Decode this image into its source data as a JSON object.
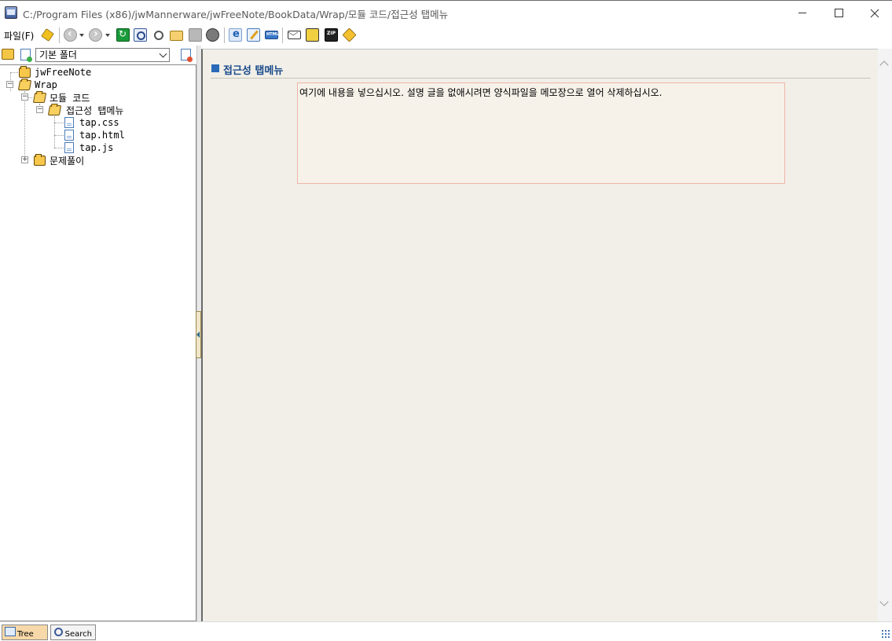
{
  "window": {
    "title": "C:/Program Files (x86)/jwMannerware/jwFreeNote/BookData/Wrap/모듈 코드/접근성 탭메뉴",
    "icon": "app-icon"
  },
  "menu": {
    "file_label": "파일(F)"
  },
  "toolbar": {
    "icons": [
      "pin-icon",
      "back-icon",
      "forward-icon",
      "refresh-icon",
      "find-icon",
      "zoom-icon",
      "open-folder-icon",
      "save-icon",
      "settings-icon",
      "ie-view-icon",
      "edit-icon",
      "html-icon",
      "mail-icon",
      "book-icon",
      "zip-icon",
      "tag-icon"
    ]
  },
  "sidebar": {
    "folder_select_value": "기본 폴더",
    "tree": [
      {
        "label": "jwFreeNote",
        "type": "folder"
      },
      {
        "label": "Wrap",
        "type": "folder",
        "expanded": true
      },
      {
        "label": "모듈 코드",
        "type": "folder",
        "expanded": true
      },
      {
        "label": "접근성 탭메뉴",
        "type": "folder-open",
        "expanded": true,
        "selected": true
      },
      {
        "label": "tap.css",
        "type": "file"
      },
      {
        "label": "tap.html",
        "type": "file"
      },
      {
        "label": "tap.js",
        "type": "file"
      },
      {
        "label": "문제풀이",
        "type": "folder",
        "expanded": false
      }
    ]
  },
  "content": {
    "heading": "접근성 탭메뉴",
    "note_text": "여기에 내용을 넣으십시오. 설명 글을 없애시려면 양식파일을 메모장으로 열어 삭제하십시오."
  },
  "bottom_tabs": {
    "tree_label": "Tree",
    "search_label": "Search"
  },
  "colors": {
    "heading": "#1a4a8a",
    "content_bg": "#f1efe8",
    "note_border": "#f0b4a8",
    "tree_tab_bg": "#f7d8a8"
  }
}
